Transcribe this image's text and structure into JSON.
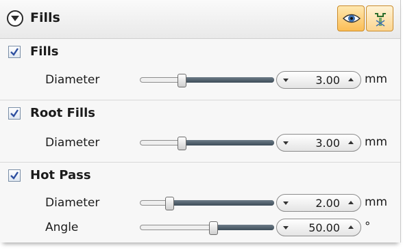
{
  "header": {
    "title": "Fills",
    "icons": [
      "collapse-icon",
      "eye-icon",
      "tool-icon"
    ]
  },
  "sections": [
    {
      "label": "Fills",
      "checked": true,
      "params": [
        {
          "label": "Diameter",
          "value": "3.00",
          "unit": "mm",
          "level": 0.3
        }
      ]
    },
    {
      "label": "Root Fills",
      "checked": true,
      "params": [
        {
          "label": "Diameter",
          "value": "3.00",
          "unit": "mm",
          "level": 0.3
        }
      ]
    },
    {
      "label": "Hot Pass",
      "checked": true,
      "params": [
        {
          "label": "Diameter",
          "value": "2.00",
          "unit": "mm",
          "level": 0.2
        },
        {
          "label": "Angle",
          "value": "50.00",
          "unit": "°",
          "level": 0.55
        }
      ]
    }
  ]
}
